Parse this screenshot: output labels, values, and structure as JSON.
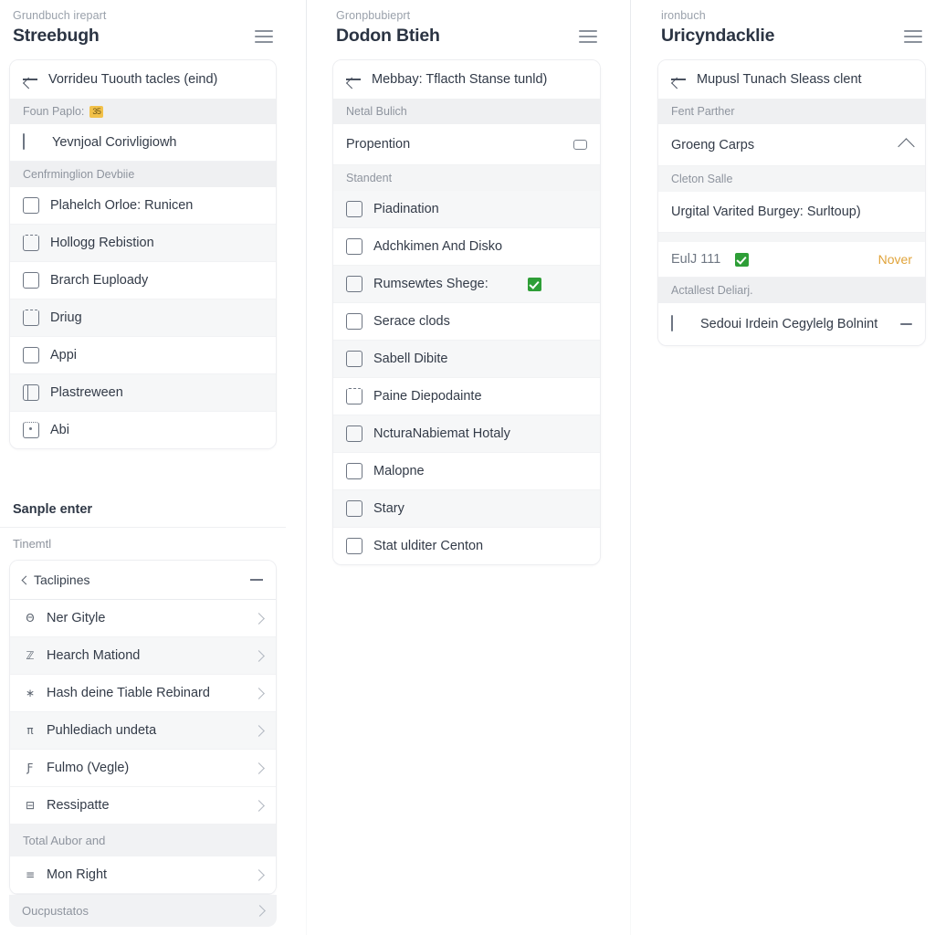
{
  "left": {
    "header": {
      "kicker": "Grundbuch irepart",
      "title": "Streebugh",
      "menu_icon": "hamburger-icon"
    },
    "back_row": {
      "label": "Vorrideu Tuouth tacles (eind)",
      "icon": "arrow-left-icon"
    },
    "sections": [
      {
        "label": "Foun Paplo:",
        "badge": "35"
      },
      {
        "label": "Cenfrminglion Devbiie"
      }
    ],
    "first_item": {
      "label": "Yevnjoal Corivligiowh",
      "icon": "monitor-icon"
    },
    "items": [
      {
        "label": "Plahelch Orloe: Runicen",
        "icon": "checkbox-icon"
      },
      {
        "label": "Hollogg Rebistion",
        "icon": "jagged-box-icon"
      },
      {
        "label": "Brarch Euploady",
        "icon": "checkbox-icon"
      },
      {
        "label": "Driug",
        "icon": "jagged-box-icon"
      },
      {
        "label": "Appi",
        "icon": "checkbox-icon"
      },
      {
        "label": "Plastreween",
        "icon": "panel-box-icon"
      },
      {
        "label": "Abi",
        "icon": "dotted-box-icon"
      }
    ]
  },
  "left_bottom": {
    "title": "Sanple enter",
    "subtitle": "Tinemtl",
    "collapse": {
      "label": "Taclipines",
      "toggle_icon": "minus-icon",
      "lead_icon": "chevron-left-icon"
    },
    "nav_items": [
      {
        "label": "Ner Gityle",
        "icon": "key-glyph-icon",
        "glyph": "Θ"
      },
      {
        "label": "Hearch Mationd",
        "icon": "tt-glyph-icon",
        "glyph": "ℤ"
      },
      {
        "label": "Hash deine Tiable Rebinard",
        "icon": "asterisk-glyph-icon",
        "glyph": "∗"
      },
      {
        "label": "Puhlediach undeta",
        "icon": "pi-glyph-icon",
        "glyph": "π"
      },
      {
        "label": "Fulmo (Vegle)",
        "icon": "f-glyph-icon",
        "glyph": "Ƒ"
      },
      {
        "label": "Ressipatte",
        "icon": "tablet-glyph-icon",
        "glyph": "⊟"
      }
    ],
    "section_label": "Total Aubor and",
    "last_item": {
      "label": "Mon Right",
      "icon": "flag-glyph-icon",
      "glyph": "≡"
    },
    "footer_row": {
      "label": "Oucpustatos",
      "icon": "chevron-right-icon"
    }
  },
  "mid": {
    "header": {
      "kicker": "Gronpbubieprt",
      "title": "Dodon Btieh",
      "menu_icon": "hamburger-icon"
    },
    "back_row": {
      "label": "Mebbay: Tflacth Stanse tunld)",
      "icon": "arrow-left-icon"
    },
    "sections": [
      {
        "label": "Netal Bulich"
      },
      {
        "label": "Standent"
      }
    ],
    "toggle_row": {
      "label": "Propention",
      "control_icon": "pill-toggle-icon"
    },
    "items": [
      {
        "label": "Piadination",
        "icon": "checkbox-icon",
        "check": false
      },
      {
        "label": "Adchkimen And Disko",
        "icon": "checkbox-icon",
        "check": false
      },
      {
        "label": "Rumsewtes Shege:",
        "icon": "checkbox-icon",
        "check": true
      },
      {
        "label": "Serace clods",
        "icon": "checkbox-icon",
        "check": false
      },
      {
        "label": "Sabell Dibite",
        "icon": "checkbox-icon",
        "check": false
      },
      {
        "label": "Paine Diepodainte",
        "icon": "jagged-box-icon",
        "check": false
      },
      {
        "label": "NcturaNabiemat Hotaly",
        "icon": "checkbox-icon",
        "check": false
      },
      {
        "label": "Malopne",
        "icon": "checkbox-icon",
        "check": false
      },
      {
        "label": "Stary",
        "icon": "checkbox-icon",
        "check": false
      },
      {
        "label": "Stat ulditer Centon",
        "icon": "checkbox-icon",
        "check": false
      }
    ]
  },
  "right": {
    "header": {
      "kicker": "ironbuch",
      "title": "Uricyndacklie",
      "menu_icon": "hamburger-icon"
    },
    "back_row": {
      "label": "Mupusl Tunach Sleass clent",
      "icon": "arrow-left-icon"
    },
    "sections": [
      {
        "label": "Fent Parther"
      },
      {
        "label": "Cleton Salle"
      },
      {
        "label": "Actallest Deliarj."
      }
    ],
    "expand_row": {
      "label": "Groeng Carps",
      "control_icon": "chevron-up-icon"
    },
    "value_row": {
      "label": "Urgital Varited Burgey: Surltoup)"
    },
    "status_row": {
      "label": "EulJ 111",
      "check": true,
      "trailing": "Nover"
    },
    "last_row": {
      "label": "Sedoui Irdein Cegylelg Bolnint",
      "icon": "monitor-icon",
      "control_icon": "minus-icon"
    }
  },
  "colors": {
    "accent_green": "#2e9e37",
    "accent_amber": "#e0a33a",
    "badge_yellow": "#f2c14a",
    "title": "#2b3443",
    "muted": "#8e949e"
  }
}
